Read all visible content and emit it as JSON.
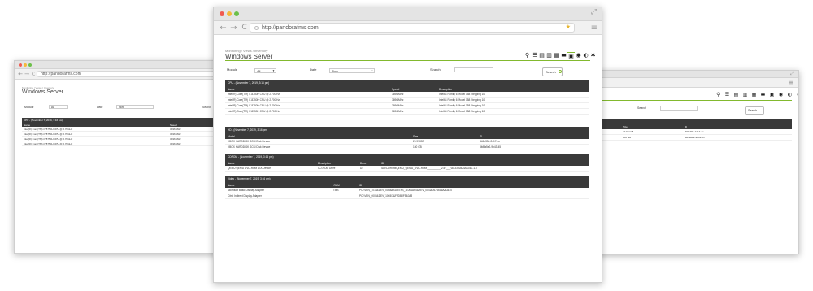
{
  "browser": {
    "url": "http://pandorafms.com",
    "back": "←",
    "forward": "→",
    "reload": "C",
    "star": "★",
    "menu": "≡",
    "expand": "⤢",
    "dot_colors": [
      "#f05a50",
      "#f5b93a",
      "#6cc04a"
    ]
  },
  "page": {
    "breadcrumb": "Monitoring / Views / Inventory",
    "title": "Windows Server",
    "accent_color": "#82b92e",
    "toolbar_icons": [
      "tree-icon",
      "list-icon",
      "doc-icon",
      "graph-icon",
      "calendar-icon",
      "folder-icon",
      "inventory-icon",
      "alert-icon",
      "history-icon",
      "settings-icon"
    ],
    "toolbar_glyphs": [
      "⚲",
      "☰",
      "▤",
      "▥",
      "▦",
      "▬",
      "▣",
      "◉",
      "◐",
      "✱"
    ]
  },
  "filters": {
    "module_label": "Module",
    "module_value": "All",
    "date_label": "Date",
    "date_value": "Now",
    "search_label": "Search",
    "search_value": "",
    "search_button": "Search",
    "search_glyph": "🔍"
  },
  "sections": [
    {
      "title": "CPU - (November 7, 2019, 3:16 pm)",
      "columns": [
        "Name",
        "Speed",
        "Description"
      ],
      "rows": [
        [
          "Intel(R) Core(TM) i7-8750H CPU @ 2.70GHz",
          "3696 MHz",
          "Intel64 Family 6 Model 158 Stepping 10"
        ],
        [
          "Intel(R) Core(TM) i7-8750H CPU @ 2.70GHz",
          "3696 MHz",
          "Intel64 Family 6 Model 158 Stepping 10"
        ],
        [
          "Intel(R) Core(TM) i7-8750H CPU @ 2.70GHz",
          "3696 MHz",
          "Intel64 Family 6 Model 158 Stepping 10"
        ],
        [
          "Intel(R) Core(TM) i7-8750H CPU @ 2.70GHz",
          "3696 MHz",
          "Intel64 Family 6 Model 158 Stepping 10"
        ]
      ]
    },
    {
      "title": "HD - (November 7, 2019, 3:16 pm)",
      "columns": [
        "Model",
        "Size",
        "ID"
      ],
      "rows": [
        [
          "VBOX HARDDISK SCSI Disk Device",
          "29.99 GB",
          "4b5e35e-2417-4c"
        ],
        [
          "VBOX HARDDISK SCSI Disk Device",
          "150 GB",
          "4fd5a5e2-9b43-45"
        ]
      ]
    },
    {
      "title": "CDROM - (November 7, 2019, 3:16 pm)",
      "columns": [
        "Name",
        "Description",
        "Drive",
        "ID"
      ],
      "rows": [
        [
          "QEMU QEMU DVD-ROM ATA Device",
          "CD-ROM Drive",
          "D:",
          "IDE\\CDROMQEMU_QEMU_DVD-ROM__________2.5+___\\5&3392824A&0&1.1.0"
        ]
      ]
    },
    {
      "title": "Video - (November 7, 2019, 3:16 pm)",
      "columns": [
        "Name",
        "vRAM",
        "ID"
      ],
      "rows": [
        [
          "Microsoft Basic Display Adapter",
          "0 MB",
          "PCI\\VEN_1013&DEV_00B8&SUBSYS_11001AF4&REV_00\\3&267A616A&0&10"
        ],
        [
          "Citrix Indirect Display Adapter",
          "",
          "PCI\\VEN_0000&DEV_1003\\7&F9DB0F5&0&5"
        ]
      ]
    }
  ]
}
